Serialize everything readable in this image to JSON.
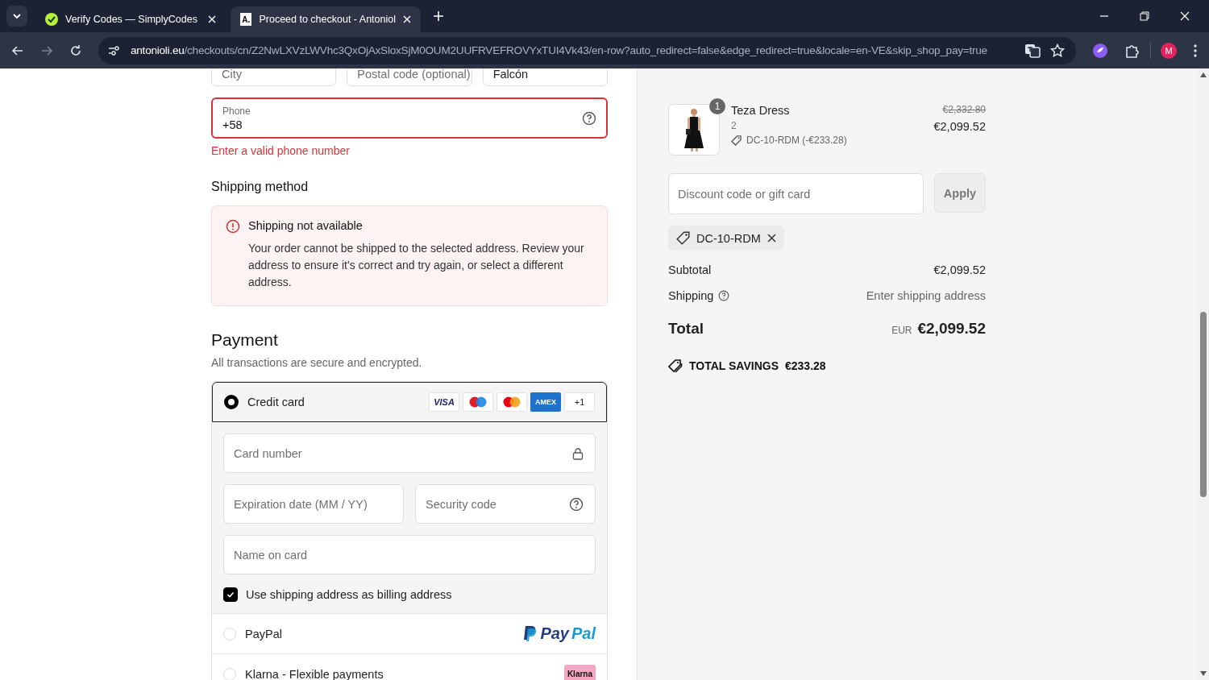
{
  "browser": {
    "tabs": [
      {
        "title": "Verify Codes — SimplyCodes",
        "selected": false,
        "kind": "check"
      },
      {
        "title": "Proceed to checkout - Antoniol",
        "selected": true,
        "kind": "letter",
        "icon_text": "A."
      }
    ],
    "url_host": "antonioli.eu",
    "url_path": "/checkouts/cn/Z2NwLXVzLWVhc3QxOjAxSloxSjM0OUM2UUFRVEFROVYxTUI4Vk43/en-row?auto_redirect=false&edge_redirect=true&locale=en-VE&skip_shop_pay=true",
    "profile_initial": "M"
  },
  "address_fields": [
    {
      "placeholder": "City"
    },
    {
      "placeholder": "Postal code (optional)"
    },
    {
      "value": "Falcón"
    }
  ],
  "phone": {
    "label": "Phone",
    "value": "+58",
    "error": "Enter a valid phone number"
  },
  "shipping_method": {
    "heading": "Shipping method",
    "alert_title": "Shipping not available",
    "alert_message": "Your order cannot be shipped to the selected address. Review your address to ensure it's correct and try again, or select a different address."
  },
  "payment": {
    "heading": "Payment",
    "subtitle": "All transactions are secure and encrypted.",
    "methods": [
      {
        "kind": "card",
        "label": "Credit card",
        "selected": true,
        "badges": [
          {
            "kind": "visa",
            "text": "VISA"
          },
          {
            "kind": "maestro"
          },
          {
            "kind": "mastercard"
          },
          {
            "kind": "amex",
            "text": "AMEX"
          },
          {
            "kind": "more",
            "text": "+1"
          }
        ]
      },
      {
        "kind": "paypal",
        "label": "PayPal",
        "selected": false,
        "logo": "PayPal"
      },
      {
        "kind": "klarna",
        "label": "Klarna - Flexible payments",
        "selected": false,
        "logo": "Klarna"
      }
    ],
    "card_number": {
      "placeholder": "Card number"
    },
    "expiry": {
      "placeholder": "Expiration date (MM / YY)"
    },
    "security": {
      "placeholder": "Security code"
    },
    "name_on_card": {
      "placeholder": "Name on card"
    },
    "billing": {
      "label": "Use shipping address as billing address",
      "checked": true
    }
  },
  "summary": {
    "item": {
      "quantity_badge": "1",
      "name": "Teza Dress",
      "variant": "2",
      "discount": "DC-10-RDM (-€233.28)",
      "original_price": "€2,332.80",
      "price": "€2,099.52"
    },
    "discount_field": {
      "placeholder": "Discount code or gift card"
    },
    "apply_button": "Apply",
    "applied_code": "DC-10-RDM",
    "subtotal_label": "Subtotal",
    "subtotal": "€2,099.52",
    "shipping_label": "Shipping",
    "shipping_value": "Enter shipping address",
    "total_label": "Total",
    "currency": "EUR",
    "total": "€2,099.52",
    "savings_label": "TOTAL SAVINGS",
    "savings": "€233.28"
  }
}
